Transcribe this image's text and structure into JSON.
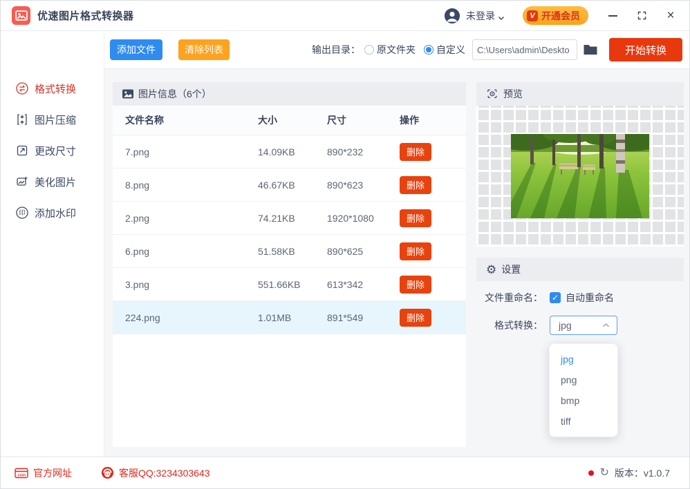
{
  "titlebar": {
    "app_title": "优速图片格式转换器",
    "login_label": "未登录",
    "vip_badge": "V",
    "vip_label": "开通会员"
  },
  "sidebar": {
    "items": [
      {
        "label": "格式转换",
        "active": true
      },
      {
        "label": "图片压缩",
        "active": false
      },
      {
        "label": "更改尺寸",
        "active": false
      },
      {
        "label": "美化图片",
        "active": false
      },
      {
        "label": "添加水印",
        "active": false
      }
    ]
  },
  "toolbar": {
    "add_files": "添加文件",
    "clear_list": "清除列表",
    "output_dir_label": "输出目录：",
    "radio_original": "原文件夹",
    "radio_custom": "自定义",
    "path_value": "C:\\Users\\admin\\Deskto",
    "start_convert": "开始转换"
  },
  "table": {
    "panel_title": "图片信息（6个）",
    "headers": [
      "文件名称",
      "大小",
      "尺寸",
      "操作"
    ],
    "delete_label": "删除",
    "rows": [
      {
        "name": "7.png",
        "size": "14.09KB",
        "dims": "890*232"
      },
      {
        "name": "8.png",
        "size": "46.67KB",
        "dims": "890*623"
      },
      {
        "name": "2.png",
        "size": "74.21KB",
        "dims": "1920*1080"
      },
      {
        "name": "6.png",
        "size": "51.58KB",
        "dims": "890*625"
      },
      {
        "name": "3.png",
        "size": "551.66KB",
        "dims": "613*342"
      },
      {
        "name": "224.png",
        "size": "1.01MB",
        "dims": "891*549"
      }
    ],
    "selected_row": "224.png"
  },
  "preview": {
    "title": "预览"
  },
  "settings": {
    "title": "设置",
    "gear_glyph": "⚙",
    "rename_label": "文件重命名：",
    "rename_check_glyph": "✓",
    "rename_checkbox_label": "自动重命名",
    "format_label": "格式转换：",
    "format_value": "jpg",
    "format_options": [
      "jpg",
      "png",
      "bmp",
      "tiff"
    ]
  },
  "footer": {
    "website_label": "官方网址",
    "qq_label": "客服QQ:3234303643",
    "refresh_glyph": "↻",
    "version_label": "版本：v1.0.7"
  },
  "colors": {
    "accent_blue": "#2e8cf0",
    "accent_orange": "#ffa21d",
    "accent_red": "#e8380d",
    "sidebar_active_red": "#d9342b",
    "footer_red": "#e22718",
    "selected_row_bg": "#e7f5fd",
    "panel_head_bg": "#ebedf0"
  }
}
